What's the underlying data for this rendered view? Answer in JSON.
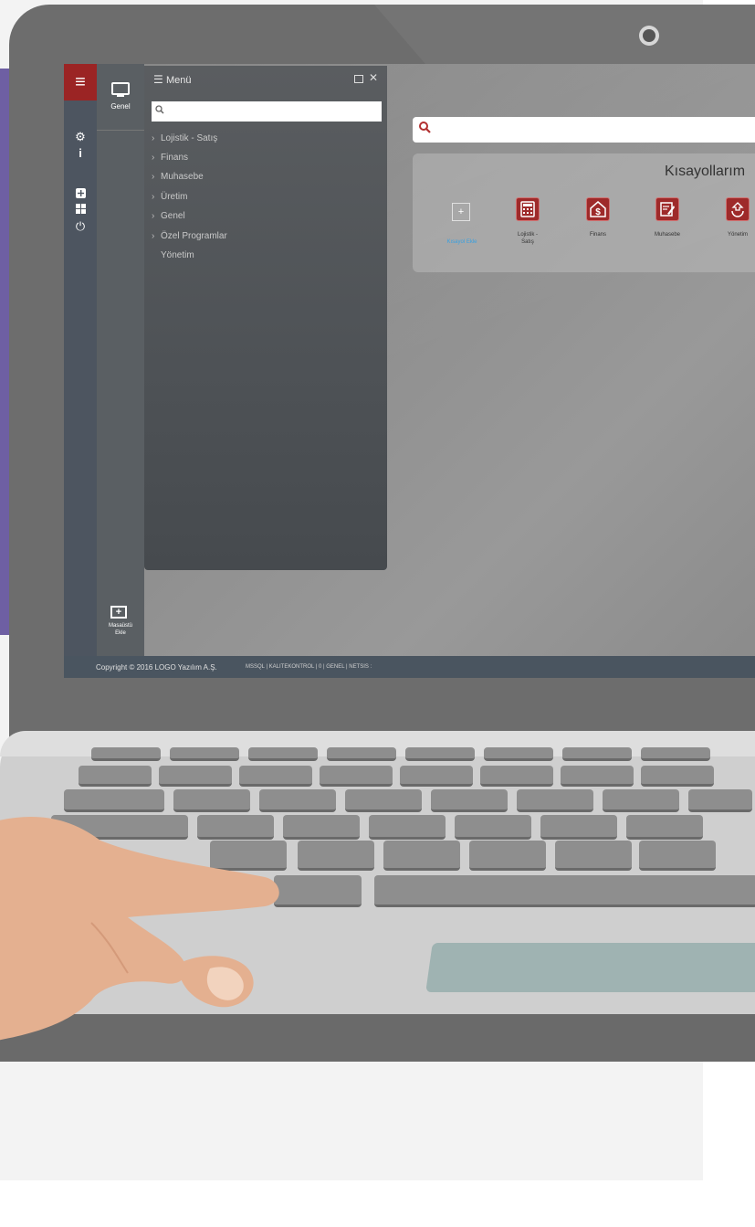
{
  "sidebar": {
    "menu_toggle": "≡",
    "genel_label": "Genel",
    "desktop_add_label_1": "Masaüstü",
    "desktop_add_label_2": "Ekle"
  },
  "menu_panel": {
    "title": "Menü",
    "search_value": "",
    "items": [
      {
        "label": "Lojistik - Satış"
      },
      {
        "label": "Finans"
      },
      {
        "label": "Muhasebe"
      },
      {
        "label": "Üretim"
      },
      {
        "label": "Genel"
      },
      {
        "label": "Özel Programlar"
      },
      {
        "label": "Yönetim"
      }
    ]
  },
  "main": {
    "search_value": "",
    "shortcuts_title": "Kısayollarım",
    "add_shortcut_label": "Kısayol Ekle",
    "shortcuts": [
      {
        "label_1": "Lojistik -",
        "label_2": "Satış",
        "icon": "calculator-icon"
      },
      {
        "label_1": "Finans",
        "label_2": "",
        "icon": "dollar-icon"
      },
      {
        "label_1": "Muhasebe",
        "label_2": "",
        "icon": "ledger-edit-icon"
      },
      {
        "label_1": "Yönetim",
        "label_2": "",
        "icon": "recycle-icon"
      }
    ]
  },
  "footer": {
    "copyright": "Copyright © 2016 LOGO Yazılım A.Ş.",
    "status": "MSSQL | KALITEKONTROL | 0 | GENEL | NETSIS :"
  },
  "colors": {
    "brand_red": "#9b2424",
    "rail": "#4d5560",
    "accent_purple": "#6e5fa3"
  }
}
